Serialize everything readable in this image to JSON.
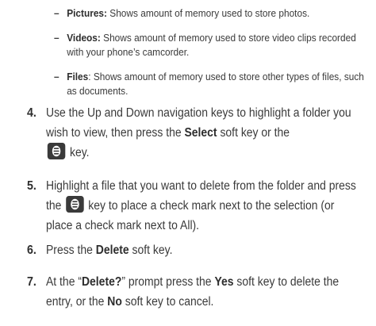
{
  "sub_items": [
    {
      "label": "Pictures:",
      "text": " Shows amount of memory used to store photos."
    },
    {
      "label": "Videos:",
      "text": " Shows amount of memory used to store video clips recorded with your phone’s camcorder."
    },
    {
      "label": "Files",
      "text": ": Shows amount of memory used to store other types of files, such as documents."
    }
  ],
  "steps": {
    "s4": {
      "number": "4.",
      "t1": "Use the Up and Down navigation keys to highlight a folder you wish to view, then press the ",
      "b1": "Select",
      "t2": " soft key or the ",
      "t3": " key."
    },
    "s5": {
      "number": "5.",
      "t1": "Highlight a file that you want to delete from the folder and press the ",
      "t2": " key to place a check mark next to the selection (or place a check mark next to All)."
    },
    "s6": {
      "number": "6.",
      "t1": "Press the ",
      "b1": "Delete",
      "t2": " soft key."
    },
    "s7": {
      "number": "7.",
      "t1": "At the “",
      "b1": "Delete?",
      "t2": "” prompt press the ",
      "b2": "Yes",
      "t3": " soft key to delete the entry, or the ",
      "b3": "No",
      "t4": " soft key to cancel."
    }
  },
  "icons": {
    "center_key": "center-select-key-icon"
  },
  "colors": {
    "text": "#3a3a3a",
    "key_bg": "#3a3a3a",
    "key_fg": "#ffffff"
  }
}
